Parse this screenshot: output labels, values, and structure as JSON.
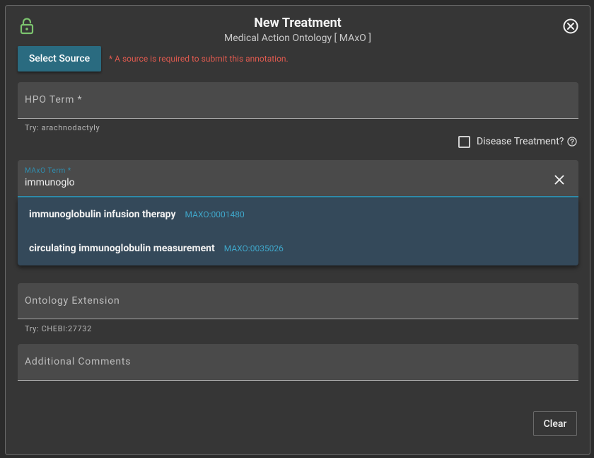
{
  "header": {
    "title": "New Treatment",
    "subtitle": "Medical Action Ontology [ MAxO ]"
  },
  "source": {
    "button_label": "Select Source",
    "warning": "* A source is required to submit this annotation."
  },
  "hpo": {
    "label": "HPO Term *",
    "hint": "Try: arachnodactyly"
  },
  "disease_treatment": {
    "label": "Disease Treatment?",
    "checked": false
  },
  "maxo": {
    "label": "MAxO Term *",
    "value": "immunoglo"
  },
  "suggestions": [
    {
      "name": "immunoglobulin infusion therapy",
      "code": "MAXO:0001480"
    },
    {
      "name": "circulating immunoglobulin measurement",
      "code": "MAXO:0035026"
    }
  ],
  "extension": {
    "label": "Ontology Extension",
    "hint": "Try: CHEBI:27732"
  },
  "comments": {
    "label": "Additional Comments"
  },
  "footer": {
    "clear_label": "Clear"
  },
  "icons": {
    "lock": "unlocked-padlock-icon",
    "close": "circle-x-icon",
    "help": "question-circle-icon",
    "clear": "x-icon"
  },
  "colors": {
    "primary": "#2a6b80",
    "accent": "#2f8fb1",
    "error": "#e05a4f",
    "lock": "#7cc46e"
  }
}
